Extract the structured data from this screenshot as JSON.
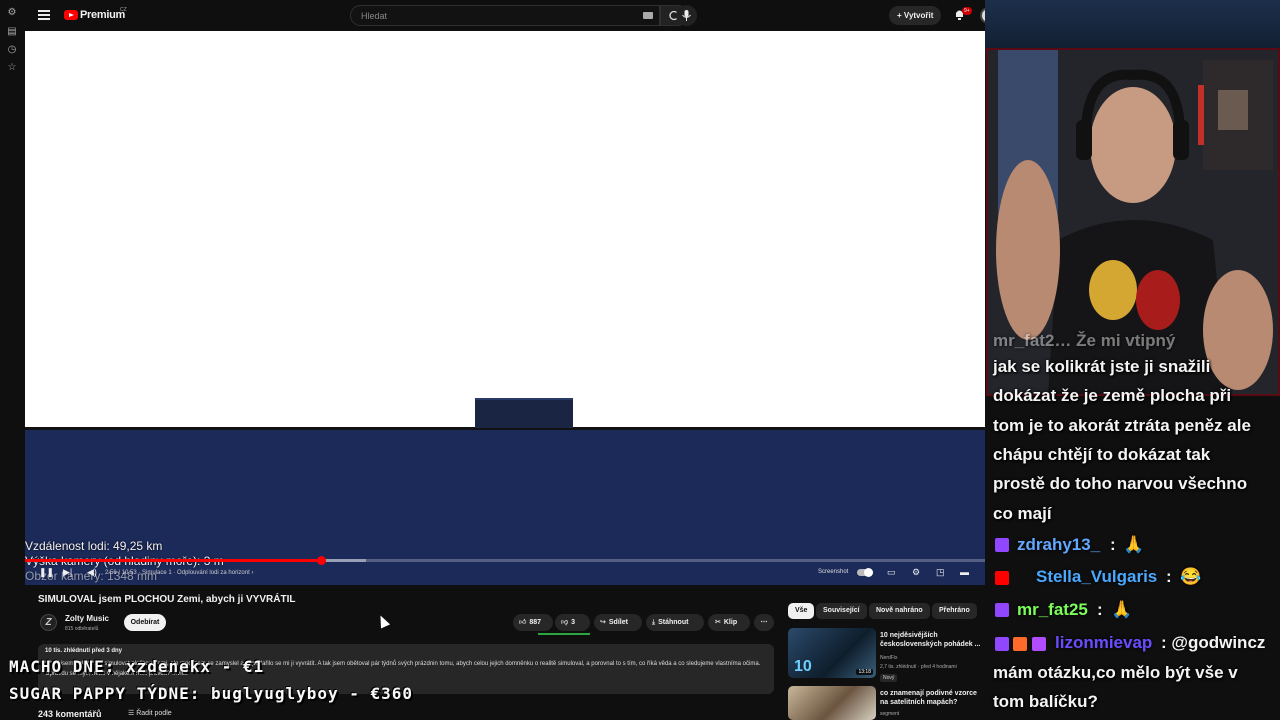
{
  "topbar": {
    "brand": "Premium",
    "brand_region": "CZ",
    "search_placeholder": "Hledat",
    "create_label": "Vytvořit",
    "notif_count": "9+"
  },
  "video": {
    "overlay_distance": "Vzdálenost lodi: 49,25 km",
    "overlay_height": "Výška kamery (od hladiny moře): 3 m",
    "overlay_third": "Obzor kamery: 1348 mm",
    "time": "2:56 / 10:53",
    "chapter": "Simulace 1 · Odplouvání lodi za horizont",
    "screenshot_label": "Screenshot",
    "played_fraction": 0.3,
    "loaded_fraction": 0.345
  },
  "info": {
    "title": "SIMULOVAL jsem PLOCHOU Zemi, abych ji VYVRÁTIL",
    "channel_name": "Zolty Music",
    "channel_subs": "815 odběratelů",
    "subscribe_label": "Odebírat",
    "likes": "887",
    "dislikes": "3",
    "share_label": "Sdílet",
    "download_label": "Stáhnout",
    "clip_label": "Klip",
    "desc_meta": "10 tis. zhlédnutí  před 3 dny",
    "desc_text": "Chtěl jsem jednoduše simulovat ploškou Zemi, ale moc jsem se zamyslel a nepodařilo se mi ji vyvrátit. A tak jsem obětoval pár týdnů svých prázdnin tomu, abych celou jejich domněnku o realitě simuloval, a porovnal to s tím, co říká věda a co sledujeme vlastníma očima. Opravdu se mýlí, nebo v nějakém měli pravdu?",
    "desc_more": "...více",
    "comments": "243 komentářů",
    "sort_label": "Řadit podle"
  },
  "related": {
    "chips": [
      "Vše",
      "Související",
      "Nově nahráno",
      "Přehráno"
    ],
    "items": [
      {
        "title": "10 nejděsivějších československých pohádek ...",
        "channel": "NerdFix",
        "meta": "2,7 tis. zhlédnutí · před 4 hodinami",
        "badge": "Nový",
        "duration": "13:18"
      },
      {
        "title": "co znamenají podivné vzorce na satelitních mapách?",
        "channel": "segment"
      }
    ]
  },
  "chat": {
    "message_top": "mr_fat25 : Že mi vtipný jak se kolikrát jste ji snažili dokázat že je země plocha při tom je to akorát ztráta peněz ale chápu chtějí to dokázat tak prostě do toho narvou všechno co mají",
    "lines": [
      "jak se kolikrát jste ji snažili",
      "dokázat že je země plocha při",
      "tom je to akorát ztráta peněz ale",
      "chápu chtějí to dokázat tak",
      "prostě do toho narvou všechno",
      "co mají"
    ],
    "messages": [
      {
        "user": "zdrahy13_",
        "sep": " : ",
        "color": "#62a8ff",
        "platform": "twitch"
      },
      {
        "user": "Stella_Vulgaris",
        "sep": " : ",
        "color": "#4aa8ff",
        "platform": "youtube"
      },
      {
        "user": "mr_fat25",
        "sep": " : ",
        "color": "#7cff5a",
        "platform": "twitch"
      }
    ],
    "last_user": "lizonmievap",
    "last_text": " : @godwincz",
    "last_lines": [
      "mám otázku,co mělo být vše v",
      "tom balíčku?"
    ]
  },
  "stream_overlay": {
    "line1": "MACHO DNE: xzdenekx - €1",
    "line2": "SUGAR PAPPY TÝDNE: buglyuglyboy - €360"
  },
  "colors": {
    "accent": "#ff0000",
    "sea": "#1c2a5a",
    "like_bar": "#2ba640"
  }
}
